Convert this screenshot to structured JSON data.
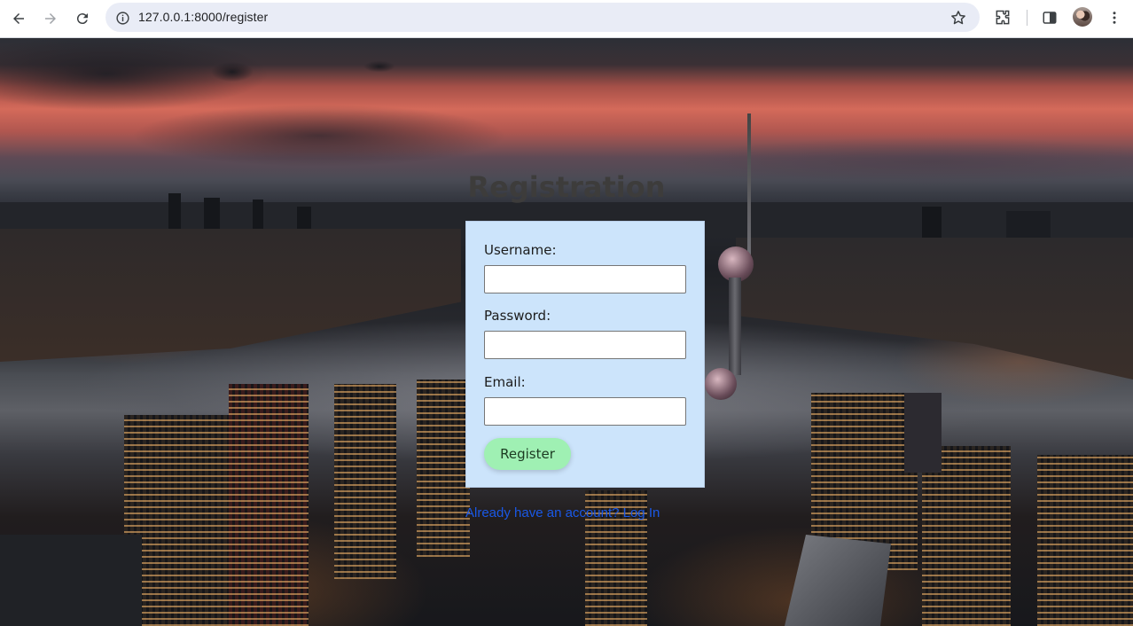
{
  "browser": {
    "url": "127.0.0.1:8000/register",
    "back_icon": "arrow-left-icon",
    "forward_icon": "arrow-right-icon",
    "reload_icon": "reload-icon",
    "site_info_icon": "info-icon",
    "bookmark_icon": "star-icon",
    "extensions_icon": "puzzle-icon",
    "sidepanel_icon": "side-panel-icon",
    "menu_icon": "kebab-menu-icon"
  },
  "page": {
    "title": "Registration",
    "form": {
      "username_label": "Username:",
      "username_value": "",
      "password_label": "Password:",
      "password_value": "",
      "email_label": "Email:",
      "email_value": "",
      "submit_label": "Register"
    },
    "login_link": "Already have an account? Log In"
  },
  "colors": {
    "card_background": "#cce4fb",
    "button_background": "#9ff0b3",
    "title_color": "#3d3c3b",
    "link_color": "#1a58e6",
    "omnibox_background": "#e9ecf6"
  }
}
